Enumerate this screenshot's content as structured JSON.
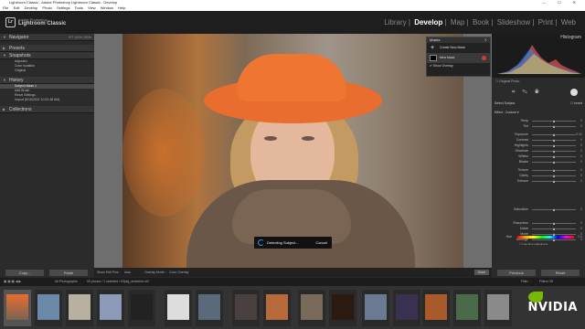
{
  "window": {
    "title": "Lightroom Classic - Adobe Photoshop Lightroom Classic - Develop"
  },
  "menu": [
    "File",
    "Edit",
    "Develop",
    "Photo",
    "Settings",
    "Tools",
    "View",
    "Window",
    "Help"
  ],
  "app": {
    "vendor": "Adobe Photoshop",
    "name": "Lightroom Classic",
    "logo": "Lr"
  },
  "modules": [
    "Library",
    "Develop",
    "Map",
    "Book",
    "Slideshow",
    "Print",
    "Web"
  ],
  "left": {
    "navigator": {
      "label": "Navigator",
      "zoom": "FIT  100%  200%"
    },
    "presets": {
      "label": "Presets"
    },
    "snapshots": {
      "label": "Snapshots",
      "items": [
        "Adjusted",
        "Color isolation",
        "Original"
      ]
    },
    "history": {
      "label": "History",
      "items": [
        "Subject Mask 1",
        "Add Brush",
        "Reset Settings",
        "Import (8/15/2021 10:51:38 AM)"
      ]
    },
    "collections": {
      "label": "Collections"
    },
    "copy_label": "Copy...",
    "paste_label": "Paste"
  },
  "masks": {
    "title": "Masks",
    "create_label": "Create New Mask",
    "new_mask_label": "New Mask",
    "overlay_label": "Show Overlay"
  },
  "detect": {
    "label": "Detecting Subject...",
    "cancel": "Cancel"
  },
  "right": {
    "histogram_label": "Histogram",
    "original_photo": "Original Photo",
    "section_label": "Select Subject",
    "invert_label": "Invert",
    "effect_label": "Effect :",
    "effect_value": "Custom",
    "sliders": [
      {
        "label": "Temp",
        "value": "0",
        "pos": 0.5
      },
      {
        "label": "Tint",
        "value": "0",
        "pos": 0.5
      },
      {
        "label": "Exposure",
        "value": "0.00",
        "pos": 0.5
      },
      {
        "label": "Contrast",
        "value": "0",
        "pos": 0.5
      },
      {
        "label": "Highlights",
        "value": "0",
        "pos": 0.5
      },
      {
        "label": "Shadows",
        "value": "0",
        "pos": 0.5
      },
      {
        "label": "Whites",
        "value": "0",
        "pos": 0.5
      },
      {
        "label": "Blacks",
        "value": "0",
        "pos": 0.5
      },
      {
        "label": "Texture",
        "value": "0",
        "pos": 0.5
      },
      {
        "label": "Clarity",
        "value": "0",
        "pos": 0.5
      },
      {
        "label": "Dehaze",
        "value": "0",
        "pos": 0.5
      },
      {
        "label": "Hue",
        "value": "0.0",
        "pos": 0.5
      },
      {
        "label": "Saturation",
        "value": "0",
        "pos": 0.5
      },
      {
        "label": "Sharpness",
        "value": "0",
        "pos": 0.5
      },
      {
        "label": "Noise",
        "value": "0",
        "pos": 0.5
      },
      {
        "label": "Moiré",
        "value": "0",
        "pos": 0.5
      },
      {
        "label": "Defringe",
        "value": "0",
        "pos": 0.5
      }
    ],
    "fine_adjust": "Use Fine Adjustment",
    "color_label": "Color",
    "previous_label": "Previous",
    "reset_label": "Reset"
  },
  "toolbar": {
    "show_edit_pins": "Show Edit Pins :",
    "auto": "Auto",
    "overlay_mode": "Overlay Mode :",
    "overlay_value": "Color Overlay",
    "done": "Done"
  },
  "filmbar": {
    "source": "All Photographs",
    "count": "93 photos / 1 selected / K5pfg_andrefurt.nf2",
    "filter": "Filter :",
    "filter_value": "Filters Off"
  },
  "brand_watermark": "NVIDIA",
  "colors": {
    "accent": "#3a8ee6",
    "hat": "#e86d2e",
    "mask_dot": "#d63a3a",
    "nvidia": "#76b900"
  }
}
